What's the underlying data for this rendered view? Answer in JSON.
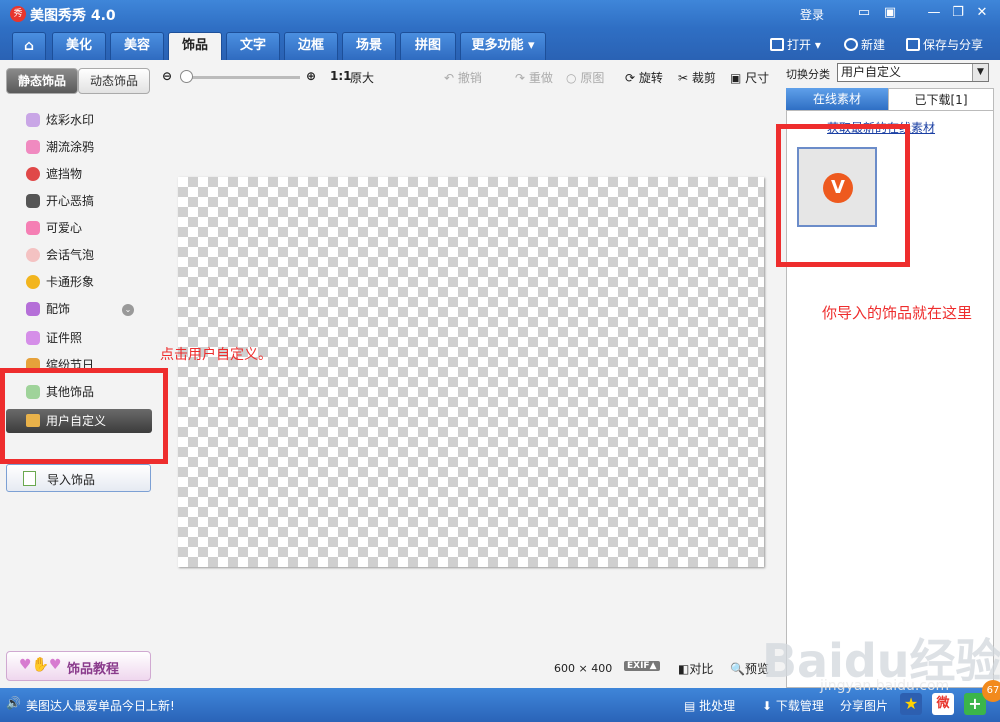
{
  "app": {
    "title": "美图秀秀 4.0",
    "logo_text": "秀",
    "login": "登录"
  },
  "tabs": [
    {
      "label": "⌂",
      "icon": "home-icon"
    },
    {
      "label": "美化"
    },
    {
      "label": "美容"
    },
    {
      "label": "饰品"
    },
    {
      "label": "文字"
    },
    {
      "label": "边框"
    },
    {
      "label": "场景"
    },
    {
      "label": "拼图"
    },
    {
      "label": "更多功能 ▾"
    }
  ],
  "top_actions": {
    "open": "打开",
    "new": "新建",
    "save_share": "保存与分享"
  },
  "left_panel": {
    "subtabs": [
      "静态饰品",
      "动态饰品"
    ],
    "categories": [
      "炫彩水印",
      "潮流涂鸦",
      "遮挡物",
      "开心恶搞",
      "可爱心",
      "会话气泡",
      "卡通形象",
      "配饰",
      "证件照",
      "缤纷节日",
      "其他饰品",
      "用户自定义"
    ],
    "selected": "用户自定义",
    "import_button": "导入饰品",
    "tutorial_button": "饰品教程"
  },
  "toolbar": {
    "zoom_ratio": "1:1",
    "original_size": "原大",
    "undo": "撤销",
    "redo": "重做",
    "original": "原图",
    "rotate": "旋转",
    "crop": "裁剪",
    "size": "尺寸"
  },
  "canvas": {
    "width_text": "600",
    "times": "×",
    "height_text": "400",
    "exif": "EXIF▲",
    "compare": "对比",
    "preview": "预览"
  },
  "right_panel": {
    "switch_label": "切换分类",
    "switch_value": "用户自定义",
    "tabs": [
      "在线素材",
      "已下载[1]"
    ],
    "link": "获取最新的在线素材",
    "thumb_letter": "V"
  },
  "statusbar": {
    "message": "美图达人最爱单品今日上新!",
    "batch": "批处理",
    "download_manage": "下载管理",
    "share": "分享图片",
    "badge": "67"
  },
  "annotations": {
    "click_hint": "点击用户自定义。",
    "imported_hint": "你导入的饰品就在这里"
  },
  "watermark": {
    "main": "Baidu经验",
    "sub": "jingyan.baidu.com"
  },
  "colors": {
    "accent": "#2f6fc4",
    "annotation_red": "#ee2d2d"
  }
}
